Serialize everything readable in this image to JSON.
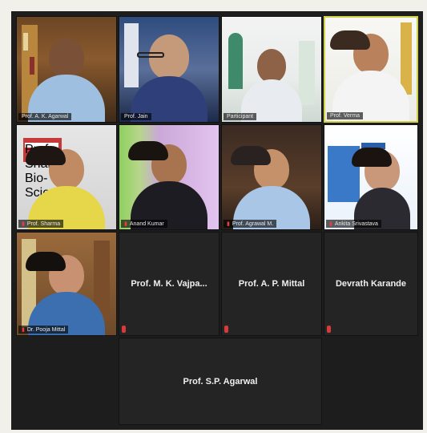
{
  "meeting": {
    "participants": [
      {
        "name": "Prof. A. K. Agarwal"
      },
      {
        "name": "Prof. Jain"
      },
      {
        "name": "Participant"
      },
      {
        "name": "Prof. Verma"
      },
      {
        "name": "Prof. Sharma",
        "banner_text": "Prof. Sharma Bio-Sciences"
      },
      {
        "name": "Anand Kumar"
      },
      {
        "name": "Prof. Agrawal M."
      },
      {
        "name": "Ankita Srivastava"
      },
      {
        "name": "Dr. Pooja Mittal"
      }
    ],
    "camera_off": [
      {
        "name": "Prof. M. K. Vajpa..."
      },
      {
        "name": "Prof. A. P. Mittal"
      },
      {
        "name": "Devrath Karande"
      },
      {
        "name": "Prof. S.P. Agarwal"
      }
    ]
  },
  "colors": {
    "grid_bg": "#1d1d1d",
    "active_speaker_border": "#cfd24a",
    "muted_mic": "#d63a3a"
  },
  "icons": {
    "mic_muted": "muted-mic-icon"
  }
}
